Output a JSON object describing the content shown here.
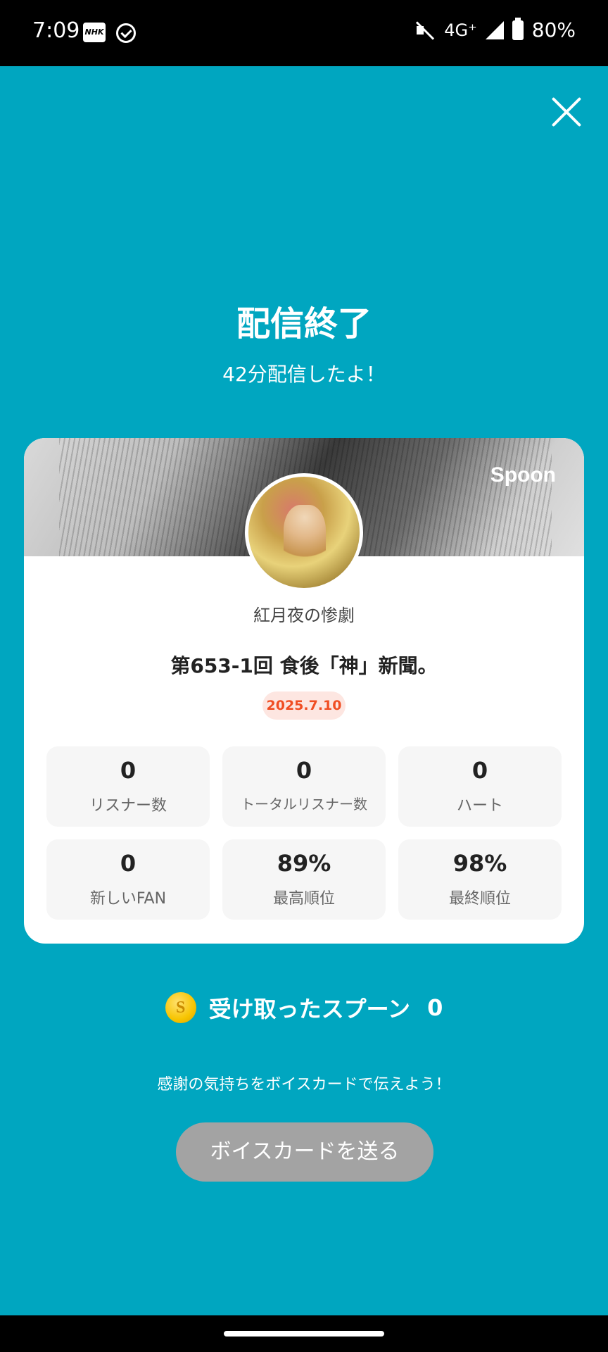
{
  "status_bar": {
    "time": "7:09",
    "nhk": "NHK",
    "network": "4G⁺",
    "battery": "80%"
  },
  "header": {
    "title": "配信終了",
    "subtitle": "42分配信したよ！"
  },
  "card": {
    "brand": "Spoon",
    "username": "紅月夜の惨劇",
    "cast_title": "第653-1回 食後「神」新聞。",
    "date": "2025.7.10",
    "stats": [
      {
        "value": "0",
        "label": "リスナー数"
      },
      {
        "value": "0",
        "label": "トータルリスナー数"
      },
      {
        "value": "0",
        "label": "ハート"
      },
      {
        "value": "0",
        "label": "新しいFAN"
      },
      {
        "value": "89%",
        "label": "最高順位"
      },
      {
        "value": "98%",
        "label": "最終順位"
      }
    ]
  },
  "spoons": {
    "coin_symbol": "S",
    "label": "受け取ったスプーン",
    "count": "0"
  },
  "voice_card": {
    "prompt": "感謝の気持ちをボイスカードで伝えよう！",
    "button_label": "ボイスカードを送る"
  },
  "colors": {
    "background": "#00a6c0",
    "date_accent": "#f04e23",
    "button_disabled": "#a3a3a3"
  }
}
